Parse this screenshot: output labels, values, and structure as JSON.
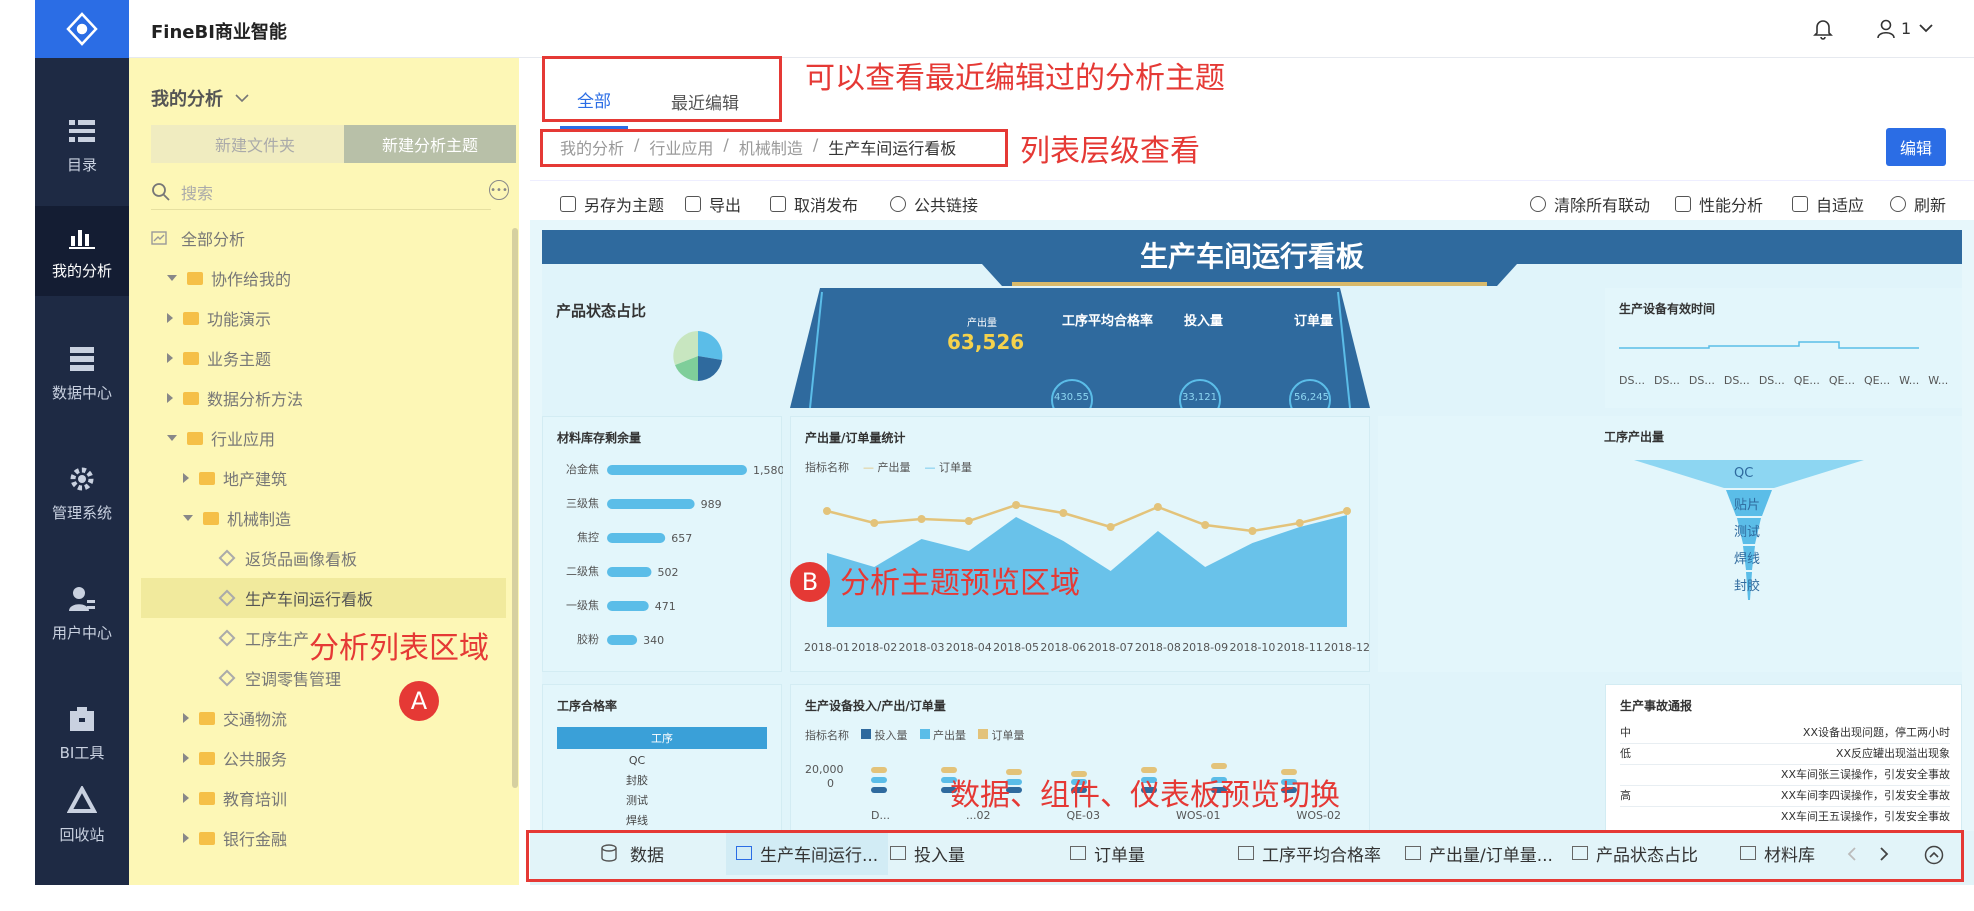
{
  "app": {
    "brand": "FineBI商业智能",
    "user": "1"
  },
  "nav": {
    "items": [
      {
        "label": "目录"
      },
      {
        "label": "我的分析"
      },
      {
        "label": "数据中心"
      },
      {
        "label": "管理系统"
      },
      {
        "label": "用户中心"
      },
      {
        "label": "BI工具"
      },
      {
        "label": "回收站"
      }
    ]
  },
  "panel": {
    "title": "我的分析",
    "new_folder": "新建文件夹",
    "new_subject": "新建分析主题",
    "search_placeholder": "搜索",
    "tree": [
      {
        "label": "全部分析"
      },
      {
        "label": "协作给我的"
      },
      {
        "label": "功能演示"
      },
      {
        "label": "业务主题"
      },
      {
        "label": "数据分析方法"
      },
      {
        "label": "行业应用"
      },
      {
        "label": "地产建筑"
      },
      {
        "label": "机械制造"
      },
      {
        "label": "返货品画像看板"
      },
      {
        "label": "生产车间运行看板"
      },
      {
        "label": "工序生产"
      },
      {
        "label": "空调零售管理"
      },
      {
        "label": "交通物流"
      },
      {
        "label": "公共服务"
      },
      {
        "label": "教育培训"
      },
      {
        "label": "银行金融"
      }
    ]
  },
  "tabs": {
    "all": "全部",
    "recent": "最近编辑"
  },
  "breadcrumb": {
    "items": [
      "我的分析",
      "行业应用",
      "机械制造",
      "生产车间运行看板"
    ],
    "sep": "/"
  },
  "edit_button": "编辑",
  "toolbar": {
    "save_as": "另存为主题",
    "export": "导出",
    "unpublish": "取消发布",
    "public_link": "公共链接",
    "clear_linkage": "清除所有联动",
    "performance": "性能分析",
    "adaptive": "自适应",
    "refresh": "刷新"
  },
  "dashboard": {
    "title": "生产车间运行看板",
    "product_status": "产品状态占比",
    "kpis": [
      {
        "label": "产出量",
        "value": "63,526"
      },
      {
        "label": "工序平均合格率",
        "value": "430.55"
      },
      {
        "label": "投入量",
        "value": "33,121"
      },
      {
        "label": "订单量",
        "value": "56,245"
      }
    ],
    "equip_time": {
      "title": "生产设备有效时间",
      "labels": [
        "DS...",
        "DS...",
        "DS...",
        "DS...",
        "DS...",
        "QE...",
        "QE...",
        "QE...",
        "W...",
        "W..."
      ]
    },
    "inventory": {
      "title": "材料库存剩余量"
    },
    "output_order": {
      "title": "产出量/订单量统计",
      "legend_title": "指标名称",
      "legend": [
        "产出量",
        "订单量"
      ]
    },
    "process_output": {
      "title": "工序产出量",
      "stages": [
        "QC",
        "贴片",
        "测试",
        "焊线",
        "封胶"
      ]
    },
    "pass_rate": {
      "title": "工序合格率",
      "col": "工序",
      "rows": [
        "QC",
        "封胶",
        "测试",
        "焊线"
      ]
    },
    "equip_io": {
      "title": "生产设备投入/产出/订单量",
      "legend_title": "指标名称",
      "legend": [
        "投入量",
        "产出量",
        "订单量"
      ],
      "y_ticks": [
        "20,000",
        "0"
      ],
      "x_labels": [
        "D...",
        "...02",
        "QE-03",
        "WOS-01",
        "WOS-02"
      ]
    },
    "accidents": {
      "title": "生产事故通报",
      "rows": [
        {
          "level": "中",
          "text": "XX设备出现问题，停工两小时"
        },
        {
          "level": "低",
          "text": "XX反应罐出现溢出现象"
        },
        {
          "level": "",
          "text": "XX车间张三误操作，引发安全事故"
        },
        {
          "level": "高",
          "text": "XX车间李四误操作，引发安全事故"
        },
        {
          "level": "",
          "text": "XX车间王五误操作，引发安全事故"
        }
      ]
    }
  },
  "chart_data": [
    {
      "type": "bar",
      "title": "材料库存剩余量",
      "categories": [
        "冶金焦",
        "三级焦",
        "焦控",
        "二级焦",
        "一级焦",
        "胶粉"
      ],
      "values": [
        1580,
        989,
        657,
        502,
        471,
        340
      ]
    },
    {
      "type": "line",
      "title": "产出量/订单量统计",
      "x": [
        "2018-01",
        "2018-02",
        "2018-03",
        "2018-04",
        "2018-05",
        "2018-06",
        "2018-07",
        "2018-08",
        "2018-09",
        "2018-10",
        "2018-11",
        "2018-12"
      ],
      "series": [
        {
          "name": "产出量",
          "values": [
            58,
            52,
            54,
            53,
            61,
            57,
            50,
            60,
            51,
            48,
            52,
            58
          ]
        },
        {
          "name": "订单量",
          "values": [
            37,
            30,
            44,
            38,
            55,
            43,
            28,
            48,
            30,
            42,
            50,
            56
          ]
        }
      ]
    }
  ],
  "annotations": {
    "recent": "可以查看最近编辑过的分析主题",
    "hierarchy": "列表层级查看",
    "preview": "分析主题预览区域",
    "list_area": "分析列表区域",
    "switch": "数据、组件、仪表板预览切换",
    "a": "A",
    "b": "B"
  },
  "bottom_tabs": {
    "data": "数据",
    "items": [
      "生产车间运行...",
      "投入量",
      "订单量",
      "工序平均合格率",
      "产出量/订单量...",
      "产品状态占比",
      "材料库"
    ]
  },
  "colors": {
    "nav_bg": "#1e2a44",
    "brand_blue": "#2b6de5",
    "panel_bg": "#fdf7b6",
    "annotation_red": "#e53935",
    "chart_blue": "#5bbde8",
    "chart_gold": "#e3c37a"
  }
}
